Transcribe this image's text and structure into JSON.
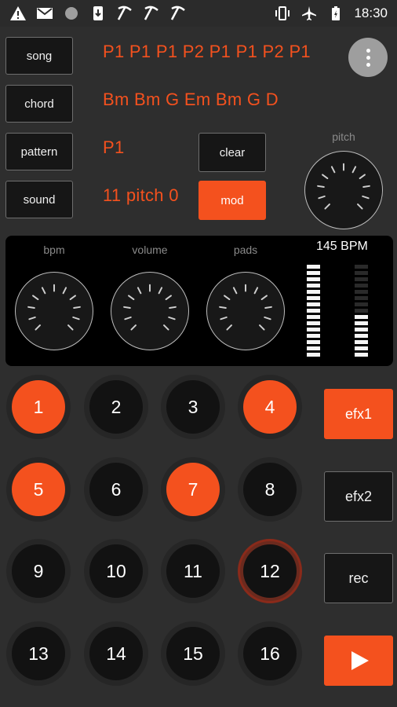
{
  "status_bar": {
    "time": "18:30",
    "left_icons": [
      "warning-icon",
      "gmail-icon",
      "circle-icon",
      "download-icon",
      "pickaxe-icon",
      "pickaxe-icon",
      "pickaxe-icon"
    ],
    "right_icons": [
      "vibrate-icon",
      "airplane-mode-icon",
      "battery-charging-icon"
    ]
  },
  "menu": {
    "song": "song",
    "chord": "chord",
    "pattern": "pattern",
    "sound": "sound"
  },
  "info": {
    "song_sequence": "P1 P1 P1 P2 P1 P1 P2 P1",
    "chord_sequence": "Bm Bm G Em Bm G D",
    "pattern": "P1",
    "sound": "11 pitch 0"
  },
  "controls": {
    "clear": "clear",
    "mod": "mod",
    "pitch_label": "pitch"
  },
  "panel": {
    "bpm_label": "bpm",
    "volume_label": "volume",
    "pads_label": "pads",
    "bpm_readout": "145 BPM",
    "meter_left_level": 1.0,
    "meter_right_level": 0.45
  },
  "pads": [
    {
      "label": "1",
      "on": true
    },
    {
      "label": "2",
      "on": false
    },
    {
      "label": "3",
      "on": false
    },
    {
      "label": "4",
      "on": true
    },
    {
      "label": "5",
      "on": true
    },
    {
      "label": "6",
      "on": false
    },
    {
      "label": "7",
      "on": true
    },
    {
      "label": "8",
      "on": false
    },
    {
      "label": "9",
      "on": false
    },
    {
      "label": "10",
      "on": false
    },
    {
      "label": "11",
      "on": false
    },
    {
      "label": "12",
      "on": false,
      "pressed": true
    },
    {
      "label": "13",
      "on": false
    },
    {
      "label": "14",
      "on": false
    },
    {
      "label": "15",
      "on": false
    },
    {
      "label": "16",
      "on": false
    }
  ],
  "side_buttons": {
    "efx1": "efx1",
    "efx2": "efx2",
    "rec": "rec",
    "play_icon": "play-icon"
  },
  "colors": {
    "accent": "#f4511e",
    "background": "#2e2e2e",
    "panel": "#000000"
  }
}
